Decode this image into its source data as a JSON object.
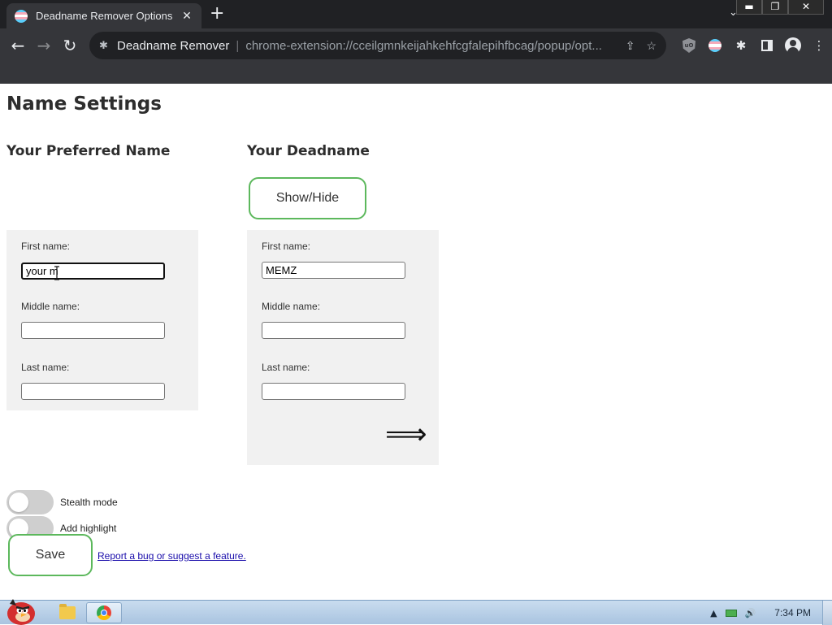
{
  "browser": {
    "tab_title": "Deadname Remover Options",
    "tab_close": "✕",
    "new_tab": "+",
    "tab_search": "⌄",
    "window_controls": {
      "minimize": "▬",
      "maximize": "❐",
      "close": "✕"
    },
    "nav": {
      "back": "←",
      "forward": "→",
      "reload": "↻"
    },
    "omnibox": {
      "site_name": "Deadname Remover",
      "separator": "|",
      "url": "chrome-extension://cceilgmnkeijahkehfcgfalepihfbcag/popup/opt...",
      "share_icon": "⇪",
      "bookmark_icon": "☆"
    },
    "extensions": {
      "puzzle_icon": "✱",
      "menu_icon": "⋮",
      "ublock_text": "uO"
    },
    "trans_flag_colors": [
      "#5bcefa",
      "#f5a9b8",
      "#ffffff",
      "#f5a9b8",
      "#5bcefa"
    ]
  },
  "page": {
    "title": "Name Settings",
    "preferred": {
      "heading": "Your Preferred Name",
      "first_label": "First name:",
      "first_value": "your m",
      "middle_label": "Middle name:",
      "middle_value": "",
      "last_label": "Last name:",
      "last_value": ""
    },
    "deadname": {
      "heading": "Your Deadname",
      "showhide_label": "Show/Hide",
      "first_label": "First name:",
      "first_value": "MEMZ",
      "middle_label": "Middle name:",
      "middle_value": "",
      "last_label": "Last name:",
      "last_value": ""
    },
    "arrow_glyph": "⟹",
    "toggles": {
      "stealth_label": "Stealth mode",
      "stealth_on": false,
      "highlight_label": "Add highlight",
      "highlight_on": false
    },
    "save_label": "Save",
    "report_link": "Report a bug or suggest a feature.",
    "accent_color": "#5cb85c"
  },
  "taskbar": {
    "tray_arrow": "▲",
    "volume_icon": "🔊",
    "clock": "7:34 PM"
  }
}
